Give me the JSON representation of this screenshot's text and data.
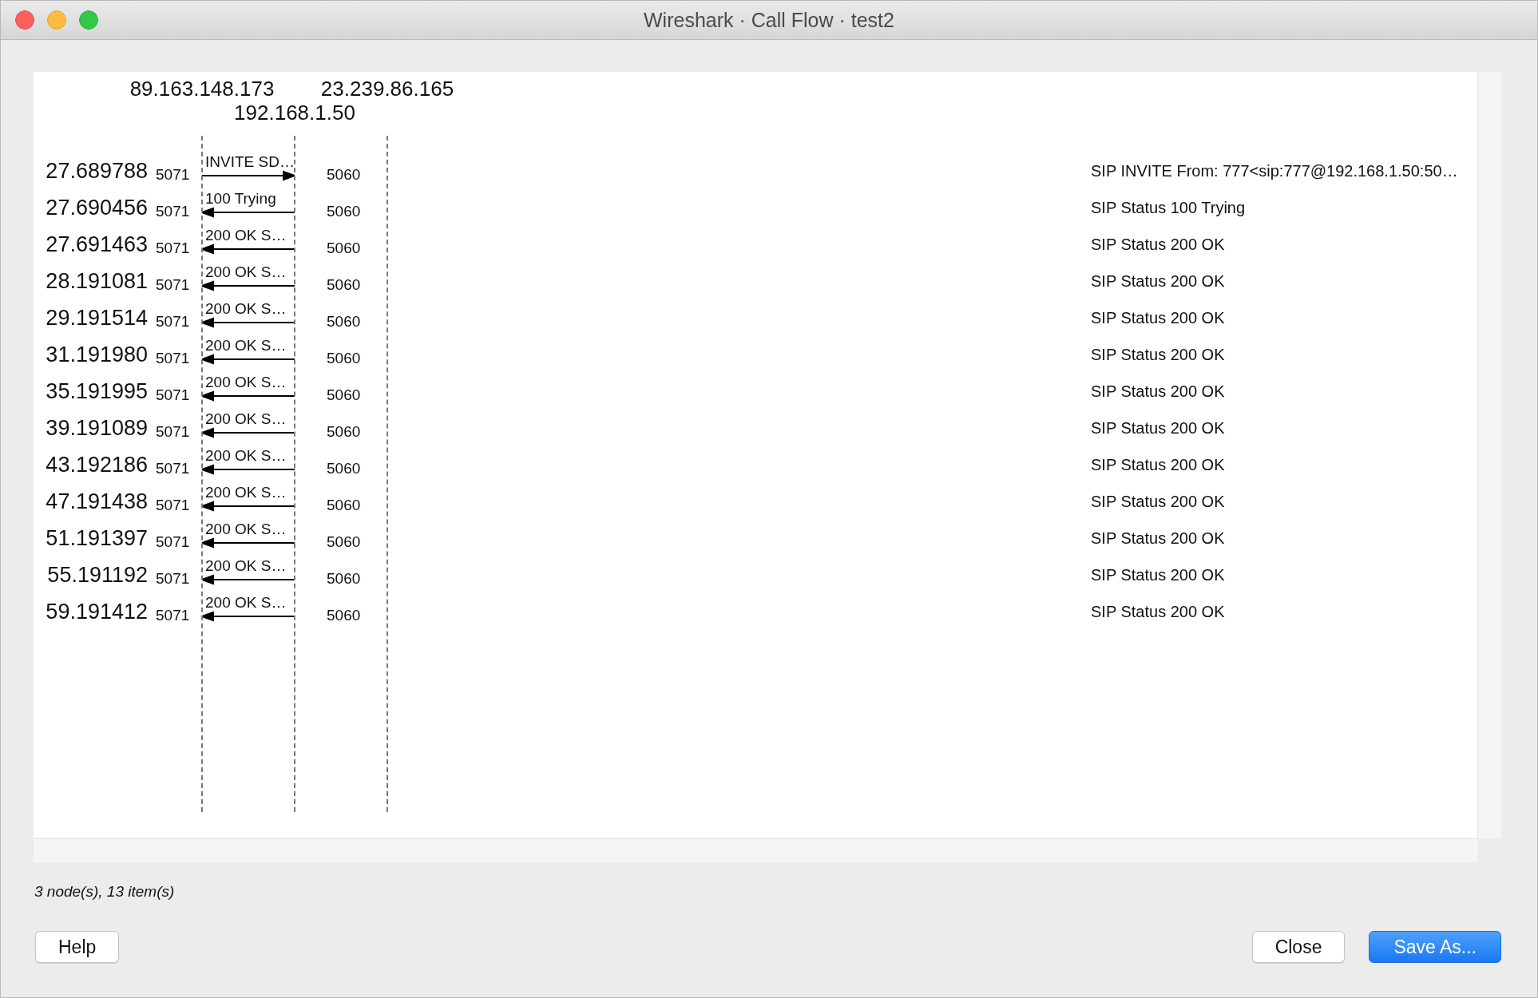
{
  "window": {
    "title": "Wireshark · Call Flow · test2"
  },
  "nodes": [
    {
      "address": "89.163.148.173"
    },
    {
      "address": "192.168.1.50"
    },
    {
      "address": "23.239.86.165"
    }
  ],
  "messages": [
    {
      "time": "27.689788",
      "left_port": "5071",
      "label": "INVITE SD…",
      "kind": "forward",
      "right_port": "5060",
      "comment": "SIP INVITE From: 777<sip:777@192.168.1.50:50…"
    },
    {
      "time": "27.690456",
      "left_port": "5071",
      "label": "100 Trying",
      "kind": "backward",
      "right_port": "5060",
      "comment": "SIP Status 100 Trying"
    },
    {
      "time": "27.691463",
      "left_port": "5071",
      "label": "200 OK S…",
      "kind": "backward",
      "right_port": "5060",
      "comment": "SIP Status 200 OK"
    },
    {
      "time": "28.191081",
      "left_port": "5071",
      "label": "200 OK S…",
      "kind": "backward",
      "right_port": "5060",
      "comment": "SIP Status 200 OK"
    },
    {
      "time": "29.191514",
      "left_port": "5071",
      "label": "200 OK S…",
      "kind": "backward",
      "right_port": "5060",
      "comment": "SIP Status 200 OK"
    },
    {
      "time": "31.191980",
      "left_port": "5071",
      "label": "200 OK S…",
      "kind": "backward",
      "right_port": "5060",
      "comment": "SIP Status 200 OK"
    },
    {
      "time": "35.191995",
      "left_port": "5071",
      "label": "200 OK S…",
      "kind": "backward",
      "right_port": "5060",
      "comment": "SIP Status 200 OK"
    },
    {
      "time": "39.191089",
      "left_port": "5071",
      "label": "200 OK S…",
      "kind": "backward",
      "right_port": "5060",
      "comment": "SIP Status 200 OK"
    },
    {
      "time": "43.192186",
      "left_port": "5071",
      "label": "200 OK S…",
      "kind": "backward",
      "right_port": "5060",
      "comment": "SIP Status 200 OK"
    },
    {
      "time": "47.191438",
      "left_port": "5071",
      "label": "200 OK S…",
      "kind": "backward",
      "right_port": "5060",
      "comment": "SIP Status 200 OK"
    },
    {
      "time": "51.191397",
      "left_port": "5071",
      "label": "200 OK S…",
      "kind": "backward",
      "right_port": "5060",
      "comment": "SIP Status 200 OK"
    },
    {
      "time": "55.191192",
      "left_port": "5071",
      "label": "200 OK S…",
      "kind": "backward",
      "right_port": "5060",
      "comment": "SIP Status 200 OK"
    },
    {
      "time": "59.191412",
      "left_port": "5071",
      "label": "200 OK S…",
      "kind": "backward",
      "right_port": "5060",
      "comment": "SIP Status 200 OK"
    }
  ],
  "status": "3 node(s), 13 item(s)",
  "buttons": [
    {
      "label": "Help",
      "kind": "default"
    },
    {
      "label": "Close",
      "kind": "default"
    },
    {
      "label": "Save As...",
      "kind": "primary"
    }
  ]
}
